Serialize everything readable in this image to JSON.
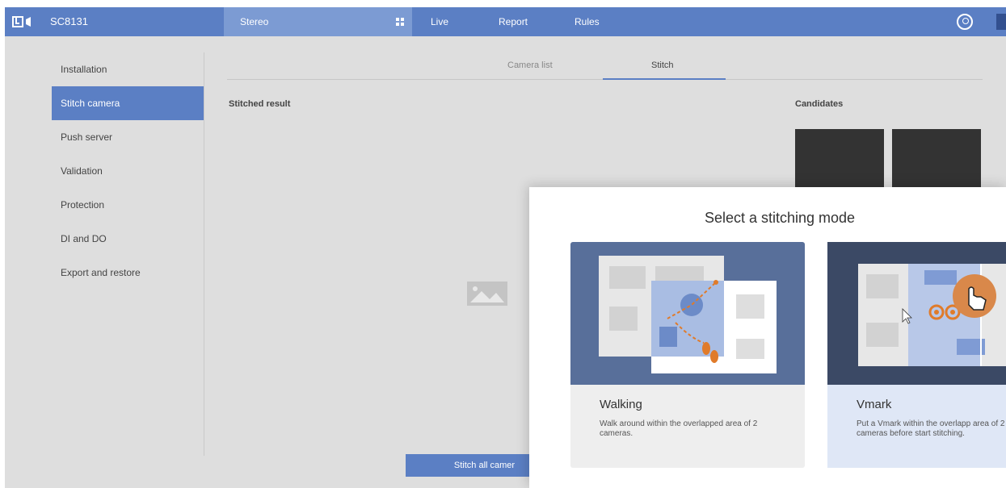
{
  "header": {
    "model": "SC8131",
    "section": "Stereo",
    "nav": [
      "Live",
      "Report",
      "Rules"
    ]
  },
  "sidebar": {
    "items": [
      {
        "label": "Installation"
      },
      {
        "label": "Stitch camera"
      },
      {
        "label": "Push server"
      },
      {
        "label": "Validation"
      },
      {
        "label": "Protection"
      },
      {
        "label": "DI and DO"
      },
      {
        "label": "Export and restore"
      }
    ]
  },
  "tabs": [
    "Camera list",
    "Stitch"
  ],
  "main": {
    "stitched_title": "Stitched result",
    "candidates_title": "Candidates",
    "stitch_button": "Stitch all camer"
  },
  "modal": {
    "title": "Select a stitching mode",
    "modes": [
      {
        "label": "Walking",
        "desc": "Walk around within the overlapped area of 2 cameras."
      },
      {
        "label": "Vmark",
        "desc": "Put a Vmark within the overlapp area of 2 cameras before start stitching."
      }
    ]
  },
  "colors": {
    "brand": "#5b7fc4",
    "walking_card": "#586f9a",
    "vmark_card": "#3b4965",
    "accent_orange": "#e07b2a"
  }
}
